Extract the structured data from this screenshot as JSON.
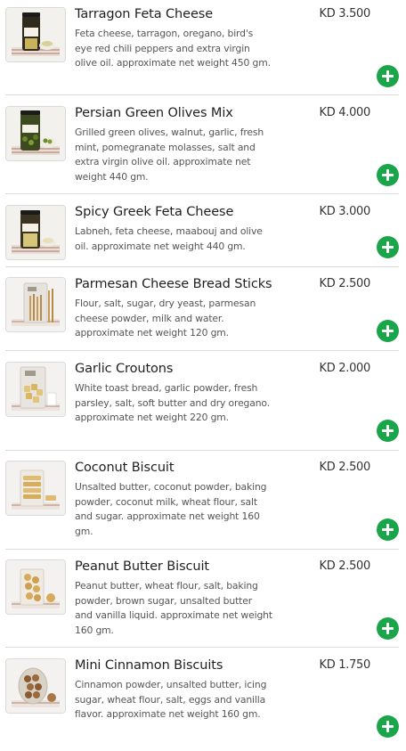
{
  "products": [
    {
      "name": "Tarragon Feta Cheese",
      "price": "KD 3.500",
      "description": "Feta cheese, tarragon, oregano, bird's eye red chili peppers and extra virgin olive oil. approximate net weight 450 gm.",
      "image_icon": "jar-product-image"
    },
    {
      "name": "Persian Green Olives Mix",
      "price": "KD 4.000",
      "description": "Grilled green olives, walnut, garlic, fresh mint, pomegranate molasses, salt and extra virgin olive oil. approximate net weight 440 gm.",
      "image_icon": "jar-product-image"
    },
    {
      "name": "Spicy Greek Feta Cheese",
      "price": "KD 3.000",
      "description": "Labneh, feta cheese, maabouj and olive oil. approximate net weight 440 gm.",
      "image_icon": "jar-product-image"
    },
    {
      "name": "Parmesan Cheese Bread Sticks",
      "price": "KD 2.500",
      "description": "Flour, salt, sugar, dry yeast, parmesan cheese powder, milk and water. approximate net weight 120 gm.",
      "image_icon": "bag-product-image"
    },
    {
      "name": "Garlic Croutons",
      "price": "KD 2.000",
      "description": "White toast bread, garlic powder, fresh parsley, salt, soft butter and dry oregano. approximate net weight 220 gm.",
      "image_icon": "bag-product-image"
    },
    {
      "name": "Coconut Biscuit",
      "price": "KD 2.500",
      "description": "Unsalted butter, coconut powder, baking powder, coconut milk, wheat flour, salt and sugar. approximate net weight 160 gm.",
      "image_icon": "biscuit-bag-image"
    },
    {
      "name": "Peanut Butter Biscuit",
      "price": "KD 2.500",
      "description": "Peanut butter, wheat flour, salt, baking powder, brown sugar, unsalted butter and vanilla liquid. approximate net weight 160 gm.",
      "image_icon": "biscuit-bag-image"
    },
    {
      "name": "Mini Cinnamon Biscuits",
      "price": "KD 1.750",
      "description": "Cinnamon powder, unsalted butter, icing sugar, wheat flour, salt, eggs and vanilla flavor. approximate net weight 160 gm.",
      "image_icon": "biscuit-bag-image"
    }
  ],
  "add_button_icon": "plus-icon",
  "colors": {
    "add_button": "#1aa54a",
    "divider": "#dcdcdc",
    "title_text": "#1f1f1f",
    "desc_text": "#555555"
  }
}
